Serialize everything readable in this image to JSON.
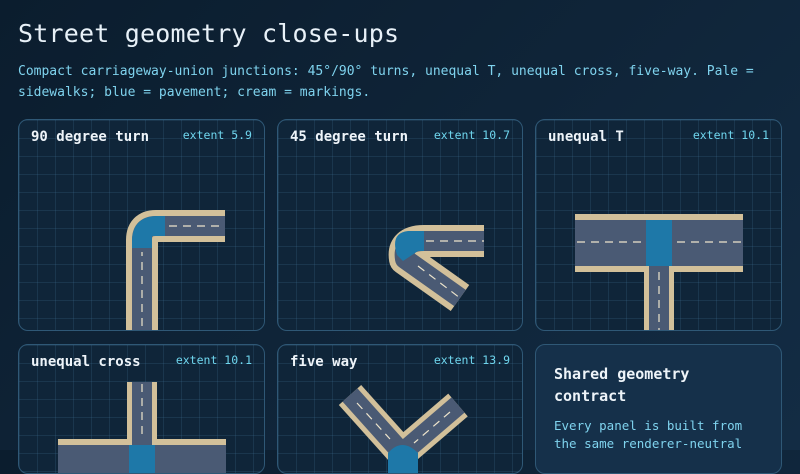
{
  "page": {
    "title": "Street geometry close-ups",
    "subtitle": "Compact carriageway-union junctions: 45°/90° turns, unequal T, unequal cross, five-way. Pale = sidewalks; blue = pavement; cream = markings."
  },
  "panels": [
    {
      "name": "90 degree turn",
      "extent": "extent 5.9"
    },
    {
      "name": "45 degree turn",
      "extent": "extent 10.7"
    },
    {
      "name": "unequal T",
      "extent": "extent 10.1"
    },
    {
      "name": "unequal cross",
      "extent": "extent 10.1"
    },
    {
      "name": "five way",
      "extent": "extent 13.9"
    }
  ],
  "info_card": {
    "title": "Shared geometry contract",
    "text": "Every panel is built from the same renderer-neutral"
  },
  "colors": {
    "sidewalk": "#d2c09a",
    "pavement": "#4a5a74",
    "junction": "#1e78a8",
    "marking": "#ede4cc"
  }
}
